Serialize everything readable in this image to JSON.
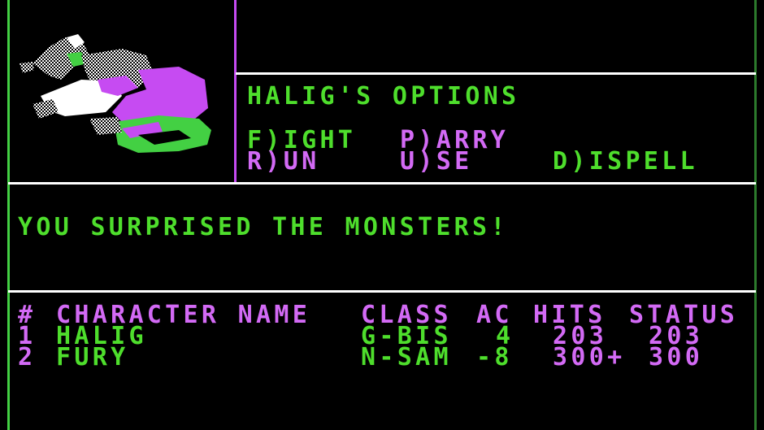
{
  "options": {
    "title": "HALIG'S OPTIONS",
    "row1": [
      "F)IGHT",
      "P)ARRY"
    ],
    "row2": [
      "R)UN",
      "U)SE",
      "D)ISPELL"
    ]
  },
  "message": "YOU SURPRISED THE MONSTERS!",
  "party": {
    "headers": {
      "num": "#",
      "name": "CHARACTER NAME",
      "class": "CLASS",
      "ac": "AC",
      "hits": "HITS",
      "status": "STATUS"
    },
    "rows": [
      {
        "num": "1",
        "name": "HALIG",
        "class": "G-BIS",
        "ac": "4",
        "hits": "203",
        "status": "203"
      },
      {
        "num": "2",
        "name": "FURY",
        "class": "N-SAM",
        "ac": "-8",
        "hits": "300+",
        "status": "300"
      }
    ]
  },
  "colors": {
    "green": "#4ede2c",
    "purple": "#d36af5",
    "white": "#ffffff",
    "background": "#000000"
  },
  "icons": {
    "portrait": "monster-portrait-icon"
  }
}
